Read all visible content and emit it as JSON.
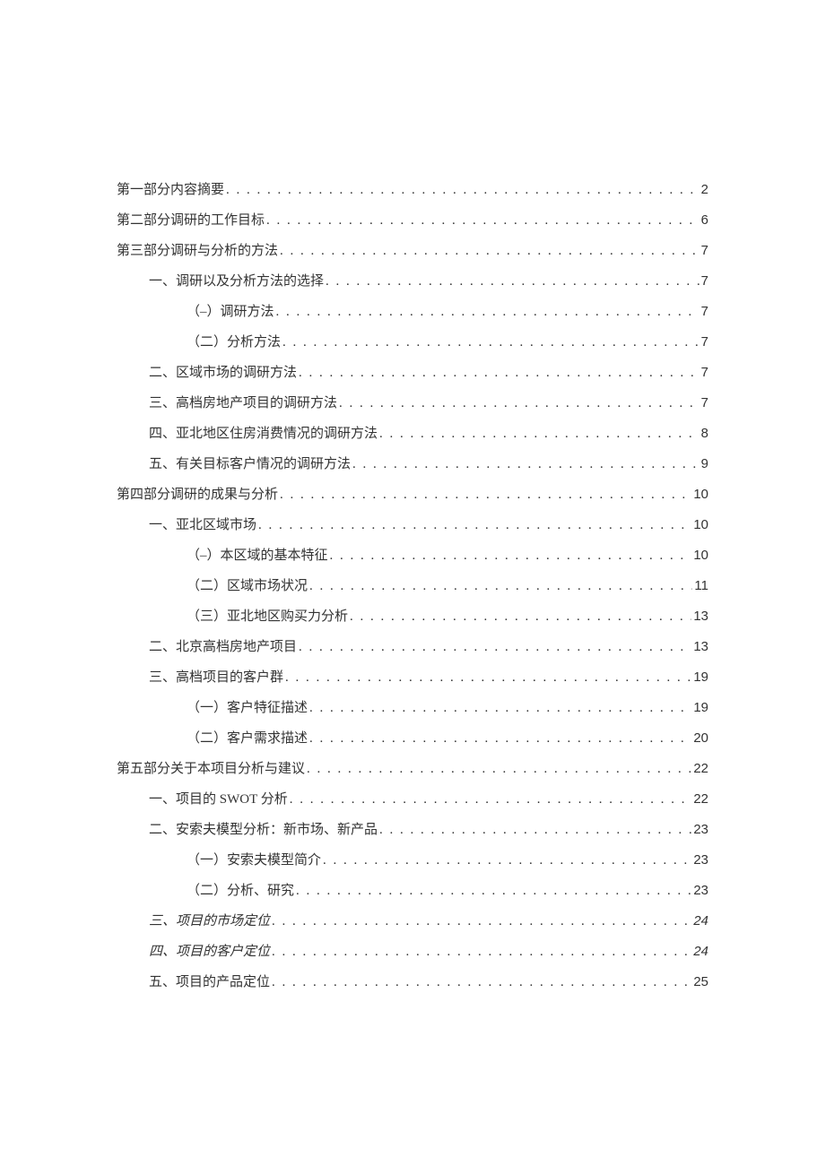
{
  "toc": [
    {
      "label": "第一部分内容摘要",
      "page": "2",
      "indent": 0,
      "italic": false
    },
    {
      "label": "第二部分调研的工作目标",
      "page": "6",
      "indent": 0,
      "italic": false
    },
    {
      "label": "第三部分调研与分析的方法",
      "page": "7",
      "indent": 0,
      "italic": false
    },
    {
      "label": "一、调研以及分析方法的选择",
      "page": "7",
      "indent": 1,
      "italic": false
    },
    {
      "label": "（–）调研方法",
      "page": "7",
      "indent": 2,
      "italic": false
    },
    {
      "label": "（二）分析方法",
      "page": "7",
      "indent": 2,
      "italic": false
    },
    {
      "label": "二、区域市场的调研方法",
      "page": "7",
      "indent": 1,
      "italic": false
    },
    {
      "label": "三、高档房地产项目的调研方法",
      "page": "7",
      "indent": 1,
      "italic": false
    },
    {
      "label": "四、亚北地区住房消费情况的调研方法",
      "page": "8",
      "indent": 1,
      "italic": false
    },
    {
      "label": "五、有关目标客户情况的调研方法",
      "page": "9",
      "indent": 1,
      "italic": false
    },
    {
      "label": "第四部分调研的成果与分析",
      "page": "10",
      "indent": 0,
      "italic": false
    },
    {
      "label": "一、亚北区域市场",
      "page": "10",
      "indent": 1,
      "italic": false
    },
    {
      "label": "（–）本区域的基本特征",
      "page": "10",
      "indent": 2,
      "italic": false
    },
    {
      "label": "（二）区域市场状况",
      "page": "11",
      "indent": 2,
      "italic": false
    },
    {
      "label": "（三）亚北地区购买力分析",
      "page": "13",
      "indent": 2,
      "italic": false
    },
    {
      "label": "二、北京高档房地产项目",
      "page": "13",
      "indent": 1,
      "italic": false
    },
    {
      "label": "三、高档项目的客户群",
      "page": "19",
      "indent": 1,
      "italic": false
    },
    {
      "label": "（一）客户特征描述",
      "page": "19",
      "indent": 2,
      "italic": false
    },
    {
      "label": "（二）客户需求描述",
      "page": "20",
      "indent": 2,
      "italic": false
    },
    {
      "label": "第五部分关于本项目分析与建议",
      "page": "22",
      "indent": 0,
      "italic": false
    },
    {
      "label": "一、项目的 SWOT 分析",
      "page": "22",
      "indent": 1,
      "italic": false
    },
    {
      "label": "二、安索夫模型分析：新市场、新产品",
      "page": "23",
      "indent": 1,
      "italic": false
    },
    {
      "label": "（一）安索夫模型简介",
      "page": "23",
      "indent": 2,
      "italic": false
    },
    {
      "label": "（二）分析、研究",
      "page": "23",
      "indent": 2,
      "italic": false
    },
    {
      "label": "三、项目的市场定位",
      "page": "24",
      "indent": 1,
      "italic": true
    },
    {
      "label": "四、项目的客户定位",
      "page": "24",
      "indent": 1,
      "italic": true
    },
    {
      "label": "五、项目的产品定位",
      "page": "25",
      "indent": 1,
      "italic": false
    }
  ]
}
